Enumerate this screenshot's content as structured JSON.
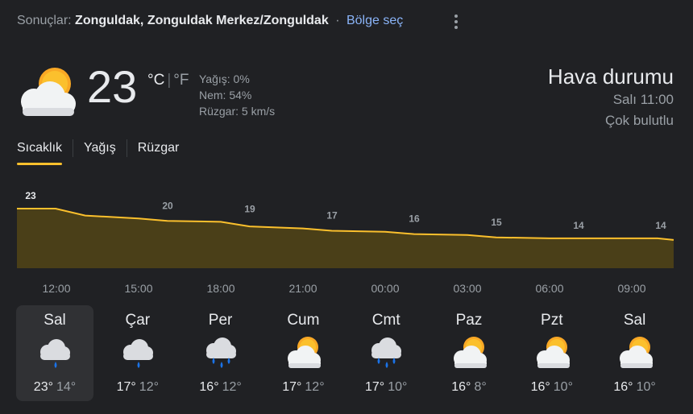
{
  "header": {
    "results_prefix": "Sonuçlar:",
    "location": "Zonguldak, Zonguldak Merkez/Zonguldak",
    "separator": "·",
    "region_link": "Bölge seç"
  },
  "current": {
    "temperature": "23",
    "unit_c": "°C",
    "unit_sep": "|",
    "unit_f": "°F",
    "precipitation": "Yağış: 0%",
    "humidity": "Nem: 54%",
    "wind": "Rüzgar: 5 km/s",
    "icon": "partly-cloudy-icon"
  },
  "summary": {
    "title": "Hava durumu",
    "time": "Salı 11:00",
    "condition": "Çok bulutlu"
  },
  "tabs": [
    {
      "label": "Sıcaklık",
      "active": true
    },
    {
      "label": "Yağış",
      "active": false
    },
    {
      "label": "Rüzgar",
      "active": false
    }
  ],
  "chart_data": {
    "type": "area",
    "x": [
      "12:00",
      "15:00",
      "18:00",
      "21:00",
      "00:00",
      "03:00",
      "06:00",
      "09:00"
    ],
    "series": [
      {
        "values": [
          23,
          20,
          19,
          17,
          16,
          15,
          14,
          14
        ]
      }
    ],
    "data_labels": [
      "23",
      "20",
      "19",
      "17",
      "16",
      "15",
      "14",
      "14"
    ],
    "line_color": "#fbc02d",
    "fill_color": "#4a3f18"
  },
  "forecast": [
    {
      "day": "Sal",
      "high": "23°",
      "low": "14°",
      "icon": "rain-icon",
      "selected": true
    },
    {
      "day": "Çar",
      "high": "17°",
      "low": "12°",
      "icon": "rain-icon",
      "selected": false
    },
    {
      "day": "Per",
      "high": "16°",
      "low": "12°",
      "icon": "heavy-rain-icon",
      "selected": false
    },
    {
      "day": "Cum",
      "high": "17°",
      "low": "12°",
      "icon": "partly-cloudy-icon",
      "selected": false
    },
    {
      "day": "Cmt",
      "high": "17°",
      "low": "10°",
      "icon": "heavy-rain-icon",
      "selected": false
    },
    {
      "day": "Paz",
      "high": "16°",
      "low": "8°",
      "icon": "partly-cloudy-icon",
      "selected": false
    },
    {
      "day": "Pzt",
      "high": "16°",
      "low": "10°",
      "icon": "partly-cloudy-icon",
      "selected": false
    },
    {
      "day": "Sal",
      "high": "16°",
      "low": "10°",
      "icon": "partly-cloudy-icon",
      "selected": false
    }
  ]
}
